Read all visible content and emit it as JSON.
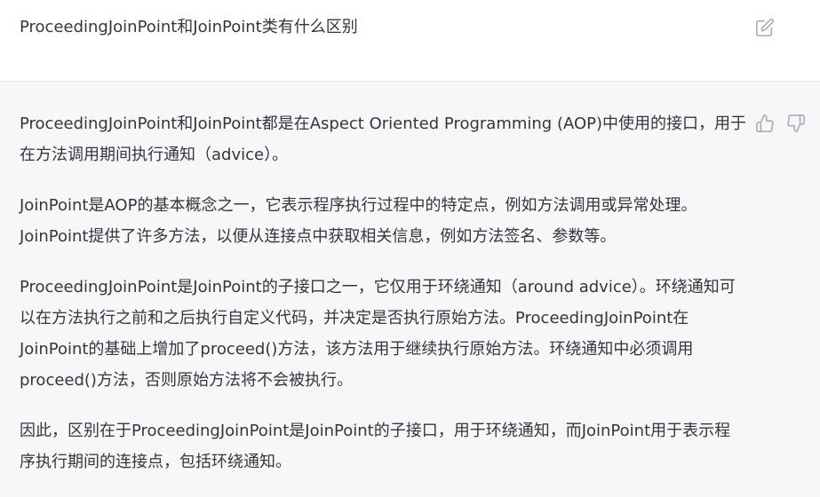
{
  "question": {
    "text": "ProceedingJoinPoint和JoinPoint类有什么区别"
  },
  "answer": {
    "paragraphs": [
      "ProceedingJoinPoint和JoinPoint都是在Aspect Oriented Programming (AOP)中使用的接口，用于在方法调用期间执行通知（advice）。",
      "JoinPoint是AOP的基本概念之一，它表示程序执行过程中的特定点，例如方法调用或异常处理。JoinPoint提供了许多方法，以便从连接点中获取相关信息，例如方法签名、参数等。",
      "ProceedingJoinPoint是JoinPoint的子接口之一，它仅用于环绕通知（around advice）。环绕通知可以在方法执行之前和之后执行自定义代码，并决定是否执行原始方法。ProceedingJoinPoint在JoinPoint的基础上增加了proceed()方法，该方法用于继续执行原始方法。环绕通知中必须调用proceed()方法，否则原始方法将不会被执行。",
      "因此，区别在于ProceedingJoinPoint是JoinPoint的子接口，用于环绕通知，而JoinPoint用于表示程序执行期间的连接点，包括环绕通知。"
    ]
  },
  "icons": {
    "edit": "edit-icon",
    "thumbs_up": "thumbs-up-icon",
    "thumbs_down": "thumbs-down-icon"
  },
  "colors": {
    "text": "#343541",
    "icon": "#acacbe",
    "answer_background": "#f7f7f8",
    "divider": "#e5e5e5"
  }
}
